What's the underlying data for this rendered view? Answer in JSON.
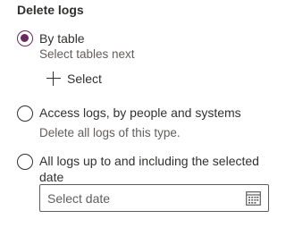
{
  "section": {
    "title": "Delete logs"
  },
  "options": [
    {
      "label": "By table",
      "checked": true,
      "description": "Select tables next",
      "action_label": "Select"
    },
    {
      "label": "Access logs, by people and systems",
      "checked": false,
      "description": "Delete all logs of this type."
    },
    {
      "label_line1": "All logs up to and including the selected",
      "label_line2": "date",
      "checked": false,
      "date_input": {
        "placeholder": "Select date",
        "icon": "calendar-icon"
      }
    }
  ],
  "colors": {
    "accent": "#6b2a5e",
    "text": "#323130",
    "secondary_text": "#605e5c"
  }
}
